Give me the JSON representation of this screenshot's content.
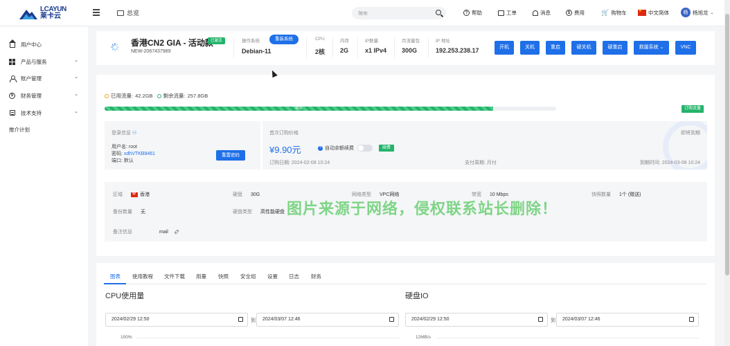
{
  "brand": {
    "en": "LCAYUN",
    "cn": "莱卡云"
  },
  "header": {
    "overview_label": "总览",
    "search_placeholder": "搜索",
    "nav": [
      {
        "label": "帮助",
        "icon": "help-icon"
      },
      {
        "label": "工单",
        "icon": "ticket-icon"
      },
      {
        "label": "消息",
        "icon": "bell-icon"
      },
      {
        "label": "费用",
        "icon": "billing-icon"
      },
      {
        "label": "购物车",
        "icon": "cart-icon"
      }
    ],
    "language": "中文简体",
    "user": {
      "avatar_text": "杨",
      "name": "杨旭龙"
    }
  },
  "sidebar": {
    "items": [
      {
        "label": "用户中心",
        "icon": "home-icon",
        "expandable": false
      },
      {
        "label": "产品与服务",
        "icon": "grid-icon",
        "expandable": true
      },
      {
        "label": "账户管理",
        "icon": "user-icon",
        "expandable": true
      },
      {
        "label": "财务管理",
        "icon": "dollar-icon",
        "expandable": true
      },
      {
        "label": "技术支持",
        "icon": "support-icon",
        "expandable": true
      },
      {
        "label": "推介计划",
        "icon": "",
        "expandable": false
      }
    ]
  },
  "server": {
    "name": "香港CN2 GIA - 活动款",
    "status": "已激活",
    "id": "NEW-2067437989",
    "os_label": "操作系统",
    "os_value": "Debian-11",
    "reinstall_label": "重装系统",
    "specs": [
      {
        "label": "CPU",
        "value": "2核"
      },
      {
        "label": "内存",
        "value": "2G"
      },
      {
        "label": "IP数量",
        "value": "x1 IPv4"
      },
      {
        "label": "月流量包",
        "value": "300G"
      },
      {
        "label": "IP 地址",
        "value": "192.253.238.17"
      }
    ],
    "actions": [
      "开机",
      "关机",
      "重启",
      "硬关机",
      "硬重启",
      "救援系统",
      "VNC"
    ]
  },
  "traffic": {
    "used_label": "已用流量:",
    "used_value": "42.2GB",
    "remaining_label": "剩余流量:",
    "remaining_value": "257.8GB",
    "progress_percent": 86,
    "progress_text": "86%",
    "order_button": "订购流量"
  },
  "login": {
    "title": "登录信息",
    "username_label": "用户名:",
    "username": "root",
    "password_label": "密码:",
    "password": "xdhVTKB8461",
    "port_label": "端口:",
    "port": "默认",
    "reset_button": "重置密码"
  },
  "billing": {
    "title": "首次订购价格",
    "price": "¥9.90元",
    "auto_renew_label": "自动余额续费",
    "renew_button": "续费",
    "expire_soon": "即将到期",
    "order_date_label": "订购日期:",
    "order_date": "2024-02-08 10:24",
    "payment_cycle_label": "支付周期:",
    "payment_cycle": "月付",
    "expire_label": "到期时间:",
    "expire_date": "2024-03-08 10:24"
  },
  "specs_detail": {
    "region_label": "区域",
    "region": "香港",
    "disk_label": "硬盘",
    "disk": "30G",
    "network_label": "网络类型",
    "network": "VPC网络",
    "bandwidth_label": "带宽",
    "bandwidth": "10 Mbps",
    "snapshot_label": "快照数量",
    "snapshot": "1个 (赠送)",
    "backup_label": "备份数量",
    "backup": "无",
    "disk_type_label": "硬盘类型",
    "disk_type": "高性能硬盘",
    "note_label": "备注信息",
    "note": "mail"
  },
  "watermark": "图片来源于网络，侵权联系站长删除！",
  "tabs": [
    "图表",
    "使用教程",
    "文件下载",
    "用量",
    "快照",
    "安全组",
    "设置",
    "日志",
    "财务"
  ],
  "charts": {
    "cpu": {
      "title": "CPU使用量",
      "start": "2024/02/29 12:50",
      "end": "2024/03/07 12:46",
      "to_label": "到",
      "y_top_label": "100%"
    },
    "disk": {
      "title": "硬盘IO",
      "start": "2024/02/29 12:50",
      "end": "2024/03/07 12:46",
      "to_label": "到",
      "y_top_label": "12MB/s"
    }
  },
  "colors": {
    "primary": "#1e6fe8",
    "success": "#23b36b",
    "warning": "#f0a020"
  }
}
